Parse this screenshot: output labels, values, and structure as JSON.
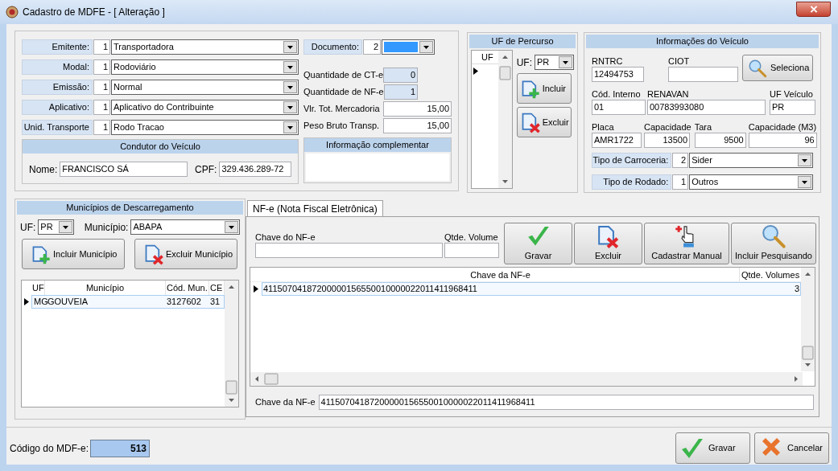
{
  "window": {
    "title": "Cadastro de MDFE - [ Alteração ]"
  },
  "general": {
    "fields": [
      {
        "label": "Emitente:",
        "code": "1",
        "value": "Transportadora"
      },
      {
        "label": "Modal:",
        "code": "1",
        "value": "Rodoviário"
      },
      {
        "label": "Emissão:",
        "code": "1",
        "value": "Normal"
      },
      {
        "label": "Aplicativo:",
        "code": "1",
        "value": "Aplicativo do Contribuinte"
      },
      {
        "label": "Unid. Transporte",
        "code": "1",
        "value": "Rodo Tracao"
      }
    ]
  },
  "documento": {
    "label": "Documento:",
    "code": "2",
    "focused": true
  },
  "totals": [
    {
      "label": "Quantidade de CT-e",
      "value": "0",
      "readonly": true
    },
    {
      "label": "Quantidade de NF-e",
      "value": "1",
      "readonly": true
    },
    {
      "label": "Vlr. Tot. Mercadoria",
      "value": "15,00",
      "readonly": false
    },
    {
      "label": "Peso Bruto Transp.",
      "value": "15,00",
      "readonly": false
    }
  ],
  "condutor": {
    "title": "Condutor do Veículo",
    "name_label": "Nome:",
    "name": "FRANCISCO SÁ",
    "cpf_label": "CPF:",
    "cpf": "329.436.289-72"
  },
  "info_complementar": {
    "title": "Informação complementar"
  },
  "uf_percurso": {
    "title": "UF de Percurso",
    "column": "UF",
    "rows": [
      {
        "selected": true
      }
    ],
    "uf_label": "UF:",
    "uf": "PR",
    "buttons": [
      {
        "label": "Incluir",
        "kind": "add"
      },
      {
        "label": "Excluir",
        "kind": "delete"
      }
    ]
  },
  "veiculo": {
    "title": "Informações do Veículo",
    "search_button": {
      "label": "Seleciona",
      "kind": "search"
    },
    "identification": {
      "rntrc_label": "RNTRC",
      "rntrc": "12494753",
      "ciot_label": "CIOT"
    },
    "registry": {
      "codigo_label": "Cód. Interno",
      "codigo": "01",
      "renavan_label": "RENAVAN",
      "renavan": "00783993080",
      "uf_label": "UF Veículo",
      "uf": "PR"
    },
    "dimensions": {
      "placa_label": "Placa",
      "placa": "AMR1722",
      "capacidade_label": "Capacidade",
      "capacidade": "13500",
      "tara_label": "Tara",
      "tara": "9500",
      "m3_label": "Capacidade (M3)",
      "m3": "96"
    },
    "selects": [
      {
        "label": "Tipo de Carroceria:",
        "code": "2",
        "value": "Sider"
      },
      {
        "label": "Tipo de Rodado:",
        "code": "1",
        "value": "Outros"
      }
    ]
  },
  "municipios": {
    "title": "Municípios de Descarregamento",
    "uf_label": "UF:",
    "uf": "PR",
    "municipio_label": "Município:",
    "municipio": "ABAPA",
    "buttons": [
      {
        "label": "Incluir Município",
        "kind": "add"
      },
      {
        "label": "Excluir Município",
        "kind": "delete"
      }
    ],
    "columns": [
      "UF",
      "Município",
      "Cód. Mun.",
      "CE"
    ],
    "rows": [
      {
        "cells": [
          "MG",
          "GOUVEIA",
          "3127602",
          "31"
        ],
        "selected": true
      }
    ]
  },
  "nfe": {
    "tabs": [
      {
        "label": "NF-e (Nota Fiscal Eletrônica)",
        "selected": true
      }
    ],
    "chave_label": "Chave do NF-e",
    "qtde_label": "Qtde. Volume",
    "buttons": [
      {
        "label": "Gravar",
        "kind": "save"
      },
      {
        "label": "Excluir",
        "kind": "delete"
      },
      {
        "label": "Cadastrar Manual",
        "kind": "manual"
      },
      {
        "label": "Incluir Pesquisando",
        "kind": "search"
      }
    ],
    "columns": [
      "Chave da NF-e",
      "Qtde. Volumes"
    ],
    "rows": [
      {
        "chave": "41150704187200000156550010000022011411968411",
        "volumes": "3",
        "selected": true
      }
    ],
    "detail_label": "Chave da NF-e",
    "detail_value": "41150704187200000156550010000022011411968411"
  },
  "footer": {
    "codigo_label": "Código do MDF-e:",
    "codigo": "513",
    "buttons": [
      {
        "label": "Gravar",
        "kind": "save"
      },
      {
        "label": "Cancelar",
        "kind": "cancel"
      }
    ]
  }
}
